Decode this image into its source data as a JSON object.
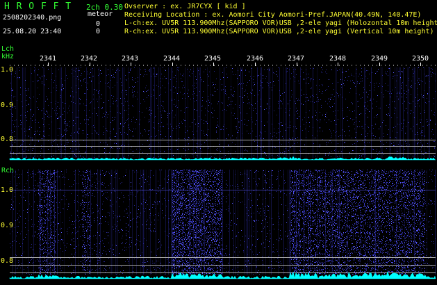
{
  "header": {
    "app_name": "H R O F F T",
    "version": "2ch 0.30",
    "filename": "2508202340.png",
    "mode": "meteor",
    "datetime": "25.08.20 23:40",
    "count_l": "0",
    "count_r": "0",
    "observer": "Ovserver            : ex. JR7CYX [ kid ]",
    "location": "Receiving Location : ex. Aomori City Aomori-Pref.JAPAN(40.49N, 140.47E)",
    "lch_info": "L-ch:ex. UV5R 113.900Mhz(SAPPORO VOR)USB ,2-ele yagi (Holozontal 10m height)",
    "rch_info": "R-ch:ex. UV5R 113.900Mhz(SAPPORO VOR)USB ,2-ele yagi (Vertical 10m height)"
  },
  "time_axis": {
    "labels": [
      "2341",
      "2342",
      "2343",
      "2344",
      "2345",
      "2346",
      "2347",
      "2348",
      "2349",
      "2350"
    ]
  },
  "lch": {
    "label": "Lch",
    "unit": "kHz",
    "ticks": [
      "1.0",
      "0.9",
      "0.8"
    ]
  },
  "rch": {
    "label": "Rch",
    "ticks": [
      "1.0",
      "0.9",
      "0.8"
    ]
  },
  "colors": {
    "label_green": "#33ff33",
    "tick_yellow": "#ffff33",
    "noise_blue": "#2a2a9a",
    "signal_blue": "#5a5aff",
    "level_cyan": "#00ffff",
    "ref_line": "#c8c8c8"
  }
}
